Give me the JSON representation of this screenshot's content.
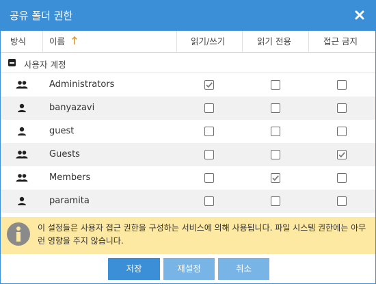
{
  "dialog": {
    "title": "공유 폴더 권한",
    "close_icon": "close-icon"
  },
  "table": {
    "headers": {
      "type": "방식",
      "name": "이름",
      "sort_icon": "sort-ascending-arrow-icon",
      "rw": "읽기/쓰기",
      "ro": "읽기 전용",
      "deny": "접근 금지"
    },
    "group": {
      "label": "사용자 계정",
      "collapse_icon": "collapse-minus-icon"
    },
    "rows": [
      {
        "name": "Administrators",
        "type_icon": "user-group-icon",
        "read_write": true,
        "read_only": false,
        "no_access": false
      },
      {
        "name": "banyazavi",
        "type_icon": "user-icon",
        "read_write": false,
        "read_only": false,
        "no_access": false
      },
      {
        "name": "guest",
        "type_icon": "user-icon",
        "read_write": false,
        "read_only": false,
        "no_access": false
      },
      {
        "name": "Guests",
        "type_icon": "user-group-icon",
        "read_write": false,
        "read_only": false,
        "no_access": true
      },
      {
        "name": "Members",
        "type_icon": "user-group-icon",
        "read_write": false,
        "read_only": true,
        "no_access": false
      },
      {
        "name": "paramita",
        "type_icon": "user-icon",
        "read_write": false,
        "read_only": false,
        "no_access": false
      }
    ]
  },
  "notice": {
    "icon": "info-icon",
    "text": "이 설정들은 사용자 접근 권한을 구성하는 서비스에 의해 사용됩니다. 파일 시스템 권한에는 아무런 영향을 주지 않습니다.",
    "background": "#fde9a2"
  },
  "buttons": {
    "save": "저장",
    "reset": "재설정",
    "cancel": "취소"
  },
  "colors": {
    "accent": "#3a8fd6",
    "accent_light": "#78b4e6",
    "row_alt": "#f1f1f1"
  }
}
